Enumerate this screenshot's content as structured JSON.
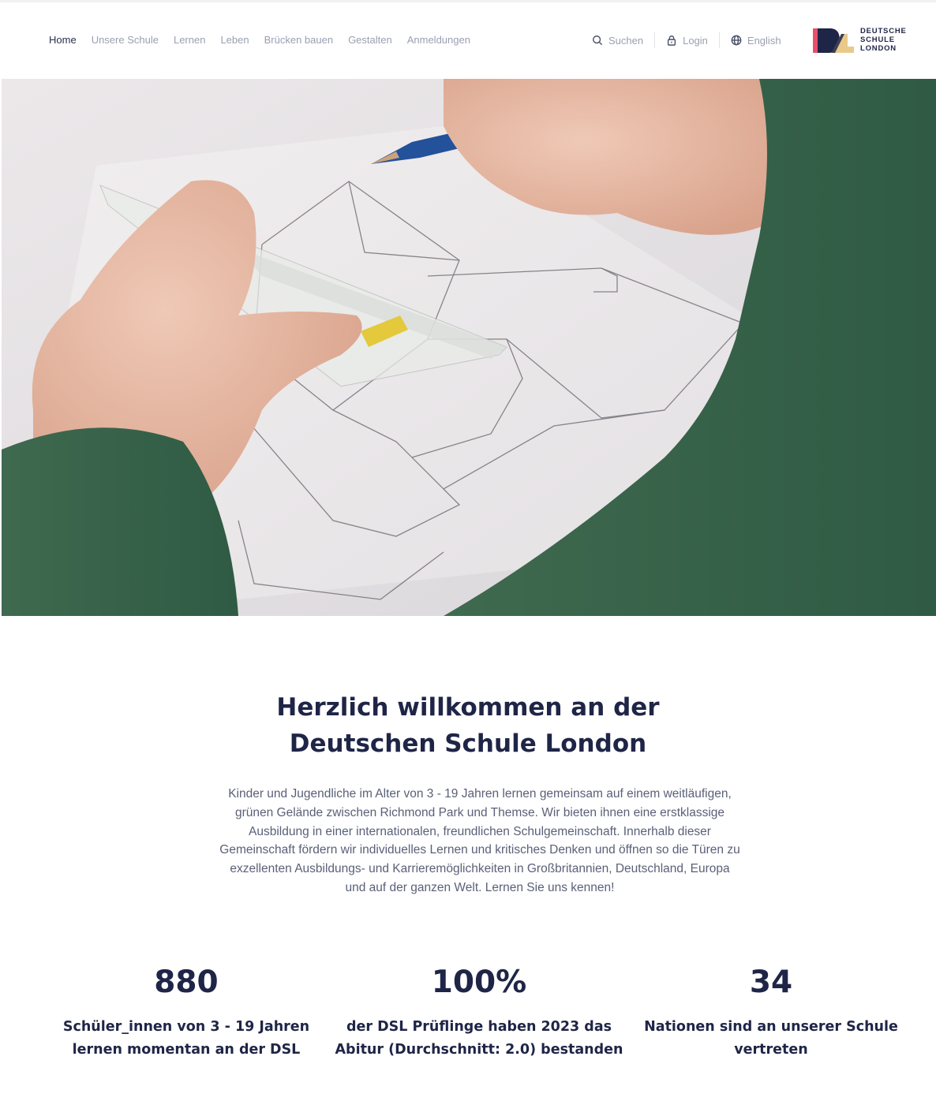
{
  "nav": {
    "items": [
      {
        "label": "Home",
        "active": true
      },
      {
        "label": "Unsere Schule",
        "active": false
      },
      {
        "label": "Lernen",
        "active": false
      },
      {
        "label": "Leben",
        "active": false
      },
      {
        "label": "Brücken bauen",
        "active": false
      },
      {
        "label": "Gestalten",
        "active": false
      },
      {
        "label": "Anmeldungen",
        "active": false
      }
    ]
  },
  "utilities": {
    "search": {
      "label": "Suchen",
      "icon": "search-icon"
    },
    "login": {
      "label": "Login",
      "icon": "lock-icon"
    },
    "language": {
      "label": "English",
      "icon": "globe-icon"
    }
  },
  "logo": {
    "lines": [
      "DEUTSCHE",
      "SCHULE",
      "LONDON"
    ],
    "colors": {
      "red": "#e8506a",
      "navy": "#1f2547",
      "sand": "#e9c98a"
    }
  },
  "hero": {
    "icon": "drawing-photo"
  },
  "welcome": {
    "title_lines": [
      "Herzlich willkommen an der",
      "Deutschen Schule London"
    ],
    "body_lines": [
      "Kinder und Jugendliche im Alter von 3 - 19 Jahren lernen gemeinsam auf einem weitläufigen,",
      "grünen Gelände zwischen Richmond Park und Themse. Wir bieten ihnen eine erstklassige",
      "Ausbildung in einer internationalen, freundlichen Schulgemeinschaft. Innerhalb dieser",
      "Gemeinschaft fördern wir individuelles Lernen und kritisches Denken und öffnen so die Türen zu",
      "exzellenten Ausbildungs- und Karrieremöglichkeiten in Großbritannien, Deutschland, Europa",
      "und auf der ganzen Welt. Lernen Sie uns kennen!"
    ]
  },
  "stats": [
    {
      "value": "880",
      "label_lines": [
        "Schüler_innen von 3 - 19 Jahren",
        "lernen momentan an der DSL"
      ]
    },
    {
      "value": "100%",
      "label_lines": [
        "der DSL Prüflinge haben 2023 das",
        "Abitur (Durchschnitt: 2.0) bestanden"
      ]
    },
    {
      "value": "34",
      "label_lines": [
        "Nationen sind an unserer Schule",
        "vertreten"
      ]
    }
  ],
  "colors": {
    "primary": "#1f2547",
    "muted": "#9aa0b0",
    "text": "#5a6078"
  }
}
